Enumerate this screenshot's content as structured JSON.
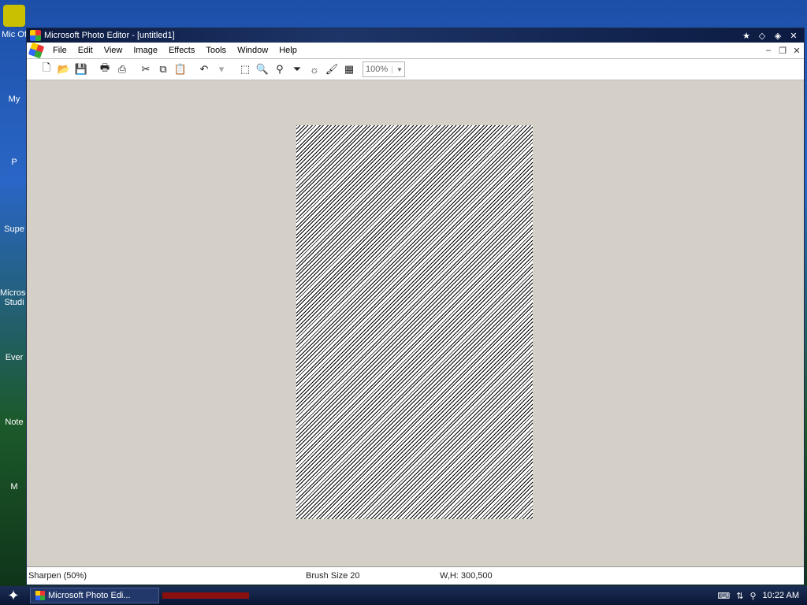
{
  "window": {
    "title": "Microsoft Photo Editor - [untitled1]"
  },
  "menu": {
    "items": [
      "File",
      "Edit",
      "View",
      "Image",
      "Effects",
      "Tools",
      "Window",
      "Help"
    ]
  },
  "toolbar": {
    "zoom_value": "100%"
  },
  "statusbar": {
    "effect": "Sharpen (50%)",
    "brush": "Brush Size 20",
    "dimensions": "W,H: 300,500"
  },
  "taskbar": {
    "task_label": "Microsoft Photo Edi...",
    "clock": "10:22 AM"
  },
  "desktop": {
    "icons": [
      "Mic Of",
      "My",
      "P",
      "Supe",
      "Microso Studi",
      "Ever",
      "Note",
      "M"
    ]
  },
  "colors": {
    "titlebar": "#1d3568",
    "workspace": "#d4d0c8",
    "taskbar": "#0b1634"
  }
}
